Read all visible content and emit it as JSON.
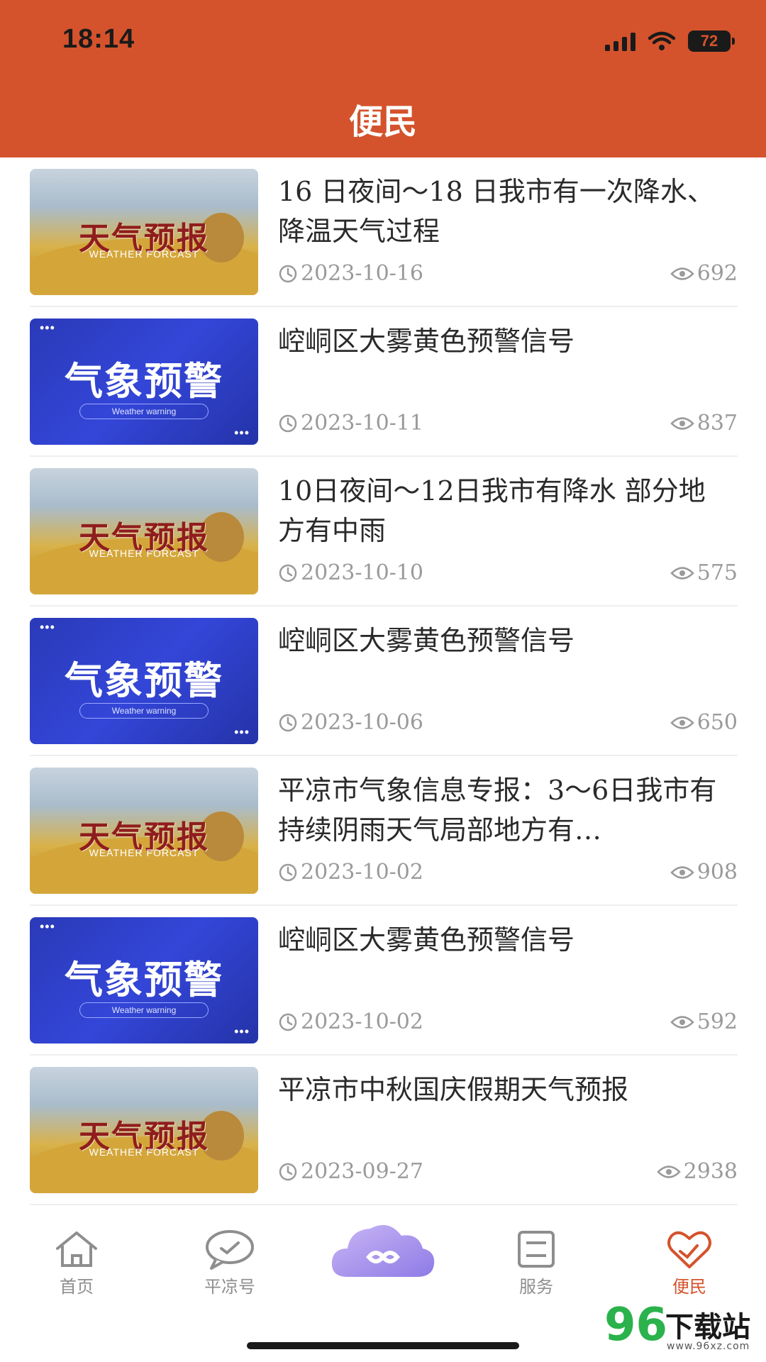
{
  "status_bar": {
    "time": "18:14",
    "battery": "72"
  },
  "header": {
    "title": "便民"
  },
  "thumbs": {
    "forecast": {
      "title": "天气预报",
      "subtitle": "WEATHER FORCAST"
    },
    "warning": {
      "title": "气象预警",
      "subtitle": "Weather warning"
    }
  },
  "items": [
    {
      "title": "16 日夜间～18 日我市有一次降水、降温天气过程",
      "date": "2023-10-16",
      "views": "692",
      "thumb": "forecast"
    },
    {
      "title": "崆峒区大雾黄色预警信号",
      "date": "2023-10-11",
      "views": "837",
      "thumb": "warning"
    },
    {
      "title": "10日夜间～12日我市有降水 部分地方有中雨",
      "date": "2023-10-10",
      "views": "575",
      "thumb": "forecast"
    },
    {
      "title": "崆峒区大雾黄色预警信号",
      "date": "2023-10-06",
      "views": "650",
      "thumb": "warning"
    },
    {
      "title": "平凉市气象信息专报：3～6日我市有持续阴雨天气局部地方有…",
      "date": "2023-10-02",
      "views": "908",
      "thumb": "forecast"
    },
    {
      "title": "崆峒区大雾黄色预警信号",
      "date": "2023-10-02",
      "views": "592",
      "thumb": "warning"
    },
    {
      "title": "平凉市中秋国庆假期天气预报",
      "date": "2023-09-27",
      "views": "2938",
      "thumb": "forecast"
    }
  ],
  "tabbar": {
    "tabs": [
      {
        "label": "首页",
        "icon": "home-icon"
      },
      {
        "label": "平凉号",
        "icon": "chat-bubble-icon"
      },
      {
        "label": "",
        "icon": "cloud-link-icon"
      },
      {
        "label": "服务",
        "icon": "service-icon"
      },
      {
        "label": "便民",
        "icon": "heart-hand-icon"
      }
    ]
  },
  "watermark": {
    "number": "96",
    "text": "下载站",
    "url": "www.96xz.com"
  },
  "colors": {
    "brand": "#D4532C",
    "text": "#2a2a2a",
    "meta": "#9a9a9a",
    "active_tab": "#D4532C"
  }
}
